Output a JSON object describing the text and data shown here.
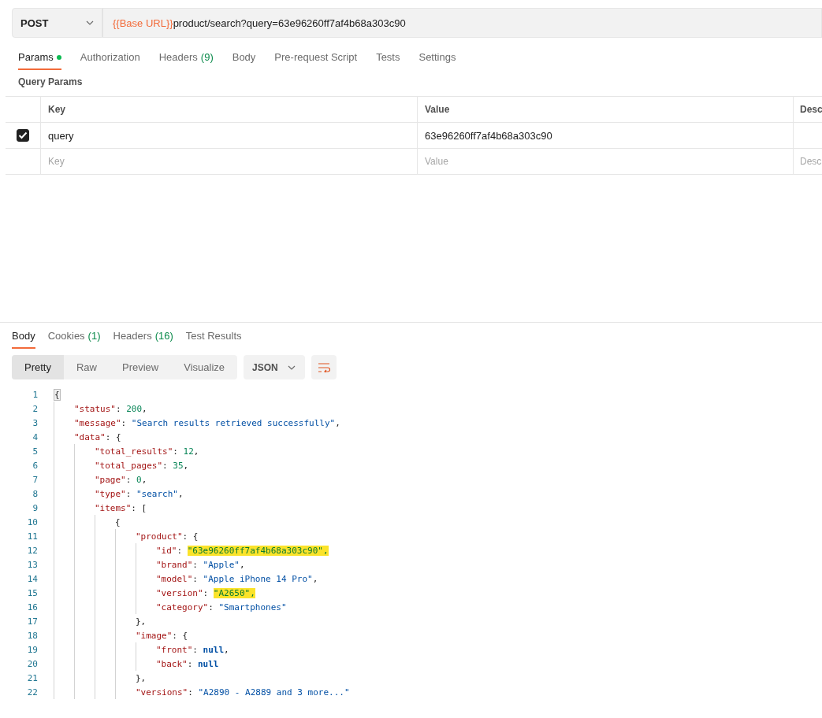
{
  "request": {
    "method": "POST",
    "url_variable": "{{Base URL}}",
    "url_path": "product/search?query=63e96260ff7af4b68a303c90"
  },
  "request_tabs": [
    {
      "label": "Params",
      "indicator": true,
      "selected": true
    },
    {
      "label": "Authorization",
      "indicator": false,
      "selected": false
    },
    {
      "label": "Headers",
      "count": "(9)",
      "indicator": false,
      "selected": false
    },
    {
      "label": "Body",
      "indicator": false,
      "selected": false
    },
    {
      "label": "Pre-request Script",
      "indicator": false,
      "selected": false
    },
    {
      "label": "Tests",
      "indicator": false,
      "selected": false
    },
    {
      "label": "Settings",
      "indicator": false,
      "selected": false
    }
  ],
  "query_params": {
    "title": "Query Params",
    "columns": [
      "Key",
      "Value",
      "Desc"
    ],
    "rows": [
      {
        "checked": true,
        "key": "query",
        "value": "63e96260ff7af4b68a303c90"
      }
    ],
    "new_row": {
      "key_placeholder": "Key",
      "value_placeholder": "Value",
      "description_placeholder": "Desc"
    }
  },
  "response_tabs": [
    {
      "label": "Body",
      "selected": true
    },
    {
      "label": "Cookies",
      "count": "(1)",
      "selected": false
    },
    {
      "label": "Headers",
      "count": "(16)",
      "selected": false
    },
    {
      "label": "Test Results",
      "selected": false
    }
  ],
  "view_modes": [
    {
      "label": "Pretty",
      "selected": true
    },
    {
      "label": "Raw",
      "selected": false
    },
    {
      "label": "Preview",
      "selected": false
    },
    {
      "label": "Visualize",
      "selected": false
    }
  ],
  "format": "JSON",
  "code_lines": [
    {
      "number": "1",
      "tokens": [
        {
          "kind": "bracket",
          "text": "{"
        }
      ],
      "children": [
        {
          "number": "2",
          "tokens": [
            {
              "kind": "key",
              "text": "\"status\""
            },
            {
              "kind": "punct",
              "text": ": "
            },
            {
              "kind": "number",
              "text": "200"
            },
            {
              "kind": "punct",
              "text": ","
            }
          ]
        },
        {
          "number": "3",
          "tokens": [
            {
              "kind": "key",
              "text": "\"message\""
            },
            {
              "kind": "punct",
              "text": ": "
            },
            {
              "kind": "string",
              "text": "\"Search results retrieved successfully\""
            },
            {
              "kind": "punct",
              "text": ","
            }
          ]
        },
        {
          "number": "4",
          "tokens": [
            {
              "kind": "key",
              "text": "\"data\""
            },
            {
              "kind": "punct",
              "text": ": {"
            }
          ],
          "children": [
            {
              "number": "5",
              "tokens": [
                {
                  "kind": "key",
                  "text": "\"total_results\""
                },
                {
                  "kind": "punct",
                  "text": ": "
                },
                {
                  "kind": "number",
                  "text": "12"
                },
                {
                  "kind": "punct",
                  "text": ","
                }
              ]
            },
            {
              "number": "6",
              "tokens": [
                {
                  "kind": "key",
                  "text": "\"total_pages\""
                },
                {
                  "kind": "punct",
                  "text": ": "
                },
                {
                  "kind": "number",
                  "text": "35"
                },
                {
                  "kind": "punct",
                  "text": ","
                }
              ]
            },
            {
              "number": "7",
              "tokens": [
                {
                  "kind": "key",
                  "text": "\"page\""
                },
                {
                  "kind": "punct",
                  "text": ": "
                },
                {
                  "kind": "number",
                  "text": "0"
                },
                {
                  "kind": "punct",
                  "text": ","
                }
              ]
            },
            {
              "number": "8",
              "tokens": [
                {
                  "kind": "key",
                  "text": "\"type\""
                },
                {
                  "kind": "punct",
                  "text": ": "
                },
                {
                  "kind": "string",
                  "text": "\"search\""
                },
                {
                  "kind": "punct",
                  "text": ","
                }
              ]
            },
            {
              "number": "9",
              "tokens": [
                {
                  "kind": "key",
                  "text": "\"items\""
                },
                {
                  "kind": "punct",
                  "text": ": ["
                }
              ],
              "children": [
                {
                  "number": "10",
                  "tokens": [
                    {
                      "kind": "punct",
                      "text": "{"
                    }
                  ],
                  "children": [
                    {
                      "number": "11",
                      "tokens": [
                        {
                          "kind": "key",
                          "text": "\"product\""
                        },
                        {
                          "kind": "punct",
                          "text": ": {"
                        }
                      ],
                      "children": [
                        {
                          "number": "12",
                          "tokens": [
                            {
                              "kind": "key",
                              "text": "\"id\""
                            },
                            {
                              "kind": "punct",
                              "text": ": "
                            },
                            {
                              "kind": "highlight",
                              "text": "\"63e96260ff7af4b68a303c90\","
                            }
                          ]
                        },
                        {
                          "number": "13",
                          "tokens": [
                            {
                              "kind": "key",
                              "text": "\"brand\""
                            },
                            {
                              "kind": "punct",
                              "text": ": "
                            },
                            {
                              "kind": "string",
                              "text": "\"Apple\""
                            },
                            {
                              "kind": "punct",
                              "text": ","
                            }
                          ]
                        },
                        {
                          "number": "14",
                          "tokens": [
                            {
                              "kind": "key",
                              "text": "\"model\""
                            },
                            {
                              "kind": "punct",
                              "text": ": "
                            },
                            {
                              "kind": "string",
                              "text": "\"Apple iPhone 14 Pro\""
                            },
                            {
                              "kind": "punct",
                              "text": ","
                            }
                          ]
                        },
                        {
                          "number": "15",
                          "tokens": [
                            {
                              "kind": "key",
                              "text": "\"version\""
                            },
                            {
                              "kind": "punct",
                              "text": ": "
                            },
                            {
                              "kind": "highlight",
                              "text": "\"A2650\","
                            }
                          ]
                        },
                        {
                          "number": "16",
                          "tokens": [
                            {
                              "kind": "key",
                              "text": "\"category\""
                            },
                            {
                              "kind": "punct",
                              "text": ": "
                            },
                            {
                              "kind": "string",
                              "text": "\"Smartphones\""
                            }
                          ]
                        }
                      ]
                    },
                    {
                      "number": "17",
                      "tokens": [
                        {
                          "kind": "punct",
                          "text": "},"
                        }
                      ]
                    },
                    {
                      "number": "18",
                      "tokens": [
                        {
                          "kind": "key",
                          "text": "\"image\""
                        },
                        {
                          "kind": "punct",
                          "text": ": {"
                        }
                      ],
                      "children": [
                        {
                          "number": "19",
                          "tokens": [
                            {
                              "kind": "key",
                              "text": "\"front\""
                            },
                            {
                              "kind": "punct",
                              "text": ": "
                            },
                            {
                              "kind": "null",
                              "text": "null"
                            },
                            {
                              "kind": "punct",
                              "text": ","
                            }
                          ]
                        },
                        {
                          "number": "20",
                          "tokens": [
                            {
                              "kind": "key",
                              "text": "\"back\""
                            },
                            {
                              "kind": "punct",
                              "text": ": "
                            },
                            {
                              "kind": "null",
                              "text": "null"
                            }
                          ]
                        }
                      ]
                    },
                    {
                      "number": "21",
                      "tokens": [
                        {
                          "kind": "punct",
                          "text": "},"
                        }
                      ]
                    },
                    {
                      "number": "22",
                      "tokens": [
                        {
                          "kind": "key",
                          "text": "\"versions\""
                        },
                        {
                          "kind": "punct",
                          "text": ": "
                        },
                        {
                          "kind": "string",
                          "text": "\"A2890 - A2889 and 3 more...\""
                        }
                      ]
                    }
                  ]
                }
              ]
            }
          ]
        }
      ]
    }
  ]
}
